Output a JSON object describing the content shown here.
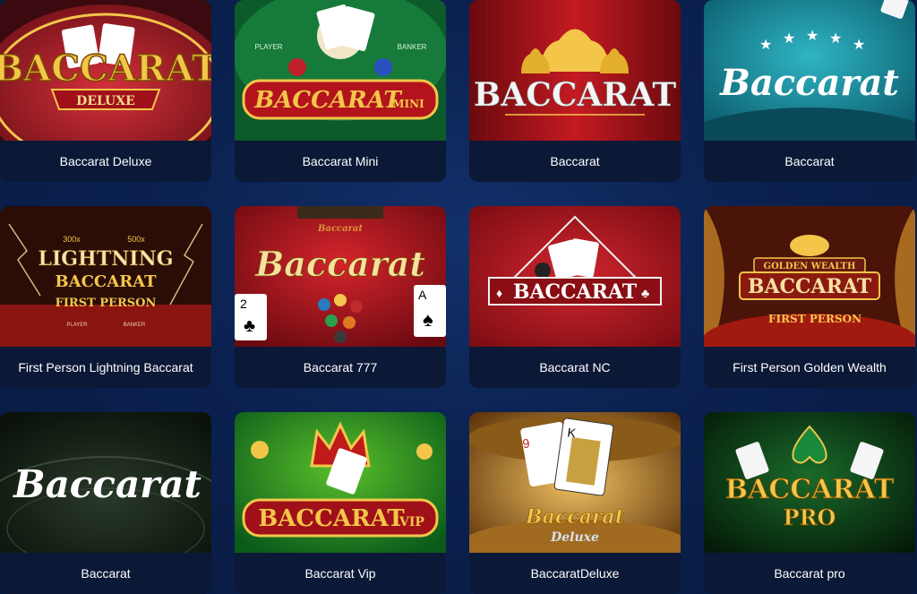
{
  "games": [
    {
      "title": "Baccarat Deluxe",
      "art": "BACCARAT",
      "art_sub": "DELUXE"
    },
    {
      "title": "Baccarat Mini",
      "art": "BACCARAT",
      "art_sub": "MINI",
      "art_left": "PLAYER",
      "art_right": "BANKER"
    },
    {
      "title": "Baccarat",
      "art": "BACCARAT"
    },
    {
      "title": "Baccarat",
      "art": "Baccarat"
    },
    {
      "title": "First Person Lightning Baccarat",
      "art": "LIGHTNING",
      "art_sub": "BACCARAT",
      "art_sub2": "FIRST PERSON",
      "art_m1": "300x",
      "art_m2": "500x",
      "art_left": "PLAYER",
      "art_right": "BANKER"
    },
    {
      "title": "Baccarat 777",
      "art": "Baccarat",
      "art_sub": "Baccarat"
    },
    {
      "title": "Baccarat NC",
      "art": "BACCARAT"
    },
    {
      "title": "First Person Golden Wealth",
      "art": "BACCARAT",
      "art_top": "GOLDEN WEALTH",
      "art_sub": "FIRST PERSON"
    },
    {
      "title": "Baccarat",
      "art": "Baccarat"
    },
    {
      "title": "Baccarat Vip",
      "art": "BACCARAT",
      "art_sub": "VIP"
    },
    {
      "title": "BaccaratDeluxe",
      "art": "Baccarat",
      "art_sub": "Deluxe"
    },
    {
      "title": "Baccarat pro",
      "art": "BACCARAT",
      "art_sub": "PRO"
    }
  ],
  "colors": {
    "page_bg": "#0b2150",
    "card_label_bg": "#0b1836",
    "label_text": "#ffffff",
    "gold": "#f3c64a",
    "red": "#b3141c"
  }
}
